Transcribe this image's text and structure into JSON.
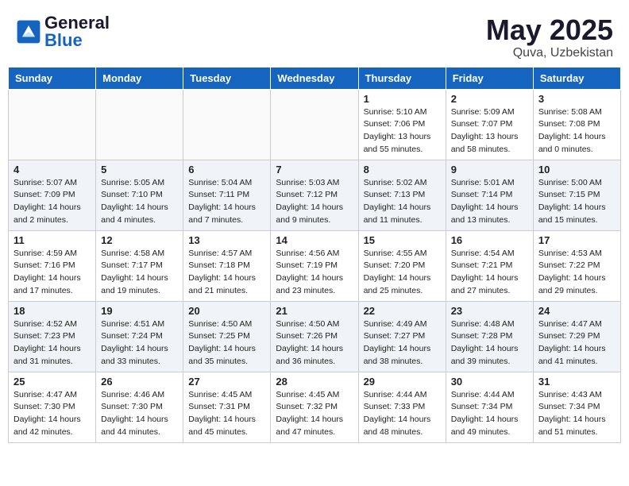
{
  "header": {
    "logo_general": "General",
    "logo_blue": "Blue",
    "month_year": "May 2025",
    "location": "Quva, Uzbekistan"
  },
  "weekdays": [
    "Sunday",
    "Monday",
    "Tuesday",
    "Wednesday",
    "Thursday",
    "Friday",
    "Saturday"
  ],
  "weeks": [
    [
      {
        "day": "",
        "sunrise": "",
        "sunset": "",
        "daylight": ""
      },
      {
        "day": "",
        "sunrise": "",
        "sunset": "",
        "daylight": ""
      },
      {
        "day": "",
        "sunrise": "",
        "sunset": "",
        "daylight": ""
      },
      {
        "day": "",
        "sunrise": "",
        "sunset": "",
        "daylight": ""
      },
      {
        "day": "1",
        "sunrise": "Sunrise: 5:10 AM",
        "sunset": "Sunset: 7:06 PM",
        "daylight": "Daylight: 13 hours and 55 minutes."
      },
      {
        "day": "2",
        "sunrise": "Sunrise: 5:09 AM",
        "sunset": "Sunset: 7:07 PM",
        "daylight": "Daylight: 13 hours and 58 minutes."
      },
      {
        "day": "3",
        "sunrise": "Sunrise: 5:08 AM",
        "sunset": "Sunset: 7:08 PM",
        "daylight": "Daylight: 14 hours and 0 minutes."
      }
    ],
    [
      {
        "day": "4",
        "sunrise": "Sunrise: 5:07 AM",
        "sunset": "Sunset: 7:09 PM",
        "daylight": "Daylight: 14 hours and 2 minutes."
      },
      {
        "day": "5",
        "sunrise": "Sunrise: 5:05 AM",
        "sunset": "Sunset: 7:10 PM",
        "daylight": "Daylight: 14 hours and 4 minutes."
      },
      {
        "day": "6",
        "sunrise": "Sunrise: 5:04 AM",
        "sunset": "Sunset: 7:11 PM",
        "daylight": "Daylight: 14 hours and 7 minutes."
      },
      {
        "day": "7",
        "sunrise": "Sunrise: 5:03 AM",
        "sunset": "Sunset: 7:12 PM",
        "daylight": "Daylight: 14 hours and 9 minutes."
      },
      {
        "day": "8",
        "sunrise": "Sunrise: 5:02 AM",
        "sunset": "Sunset: 7:13 PM",
        "daylight": "Daylight: 14 hours and 11 minutes."
      },
      {
        "day": "9",
        "sunrise": "Sunrise: 5:01 AM",
        "sunset": "Sunset: 7:14 PM",
        "daylight": "Daylight: 14 hours and 13 minutes."
      },
      {
        "day": "10",
        "sunrise": "Sunrise: 5:00 AM",
        "sunset": "Sunset: 7:15 PM",
        "daylight": "Daylight: 14 hours and 15 minutes."
      }
    ],
    [
      {
        "day": "11",
        "sunrise": "Sunrise: 4:59 AM",
        "sunset": "Sunset: 7:16 PM",
        "daylight": "Daylight: 14 hours and 17 minutes."
      },
      {
        "day": "12",
        "sunrise": "Sunrise: 4:58 AM",
        "sunset": "Sunset: 7:17 PM",
        "daylight": "Daylight: 14 hours and 19 minutes."
      },
      {
        "day": "13",
        "sunrise": "Sunrise: 4:57 AM",
        "sunset": "Sunset: 7:18 PM",
        "daylight": "Daylight: 14 hours and 21 minutes."
      },
      {
        "day": "14",
        "sunrise": "Sunrise: 4:56 AM",
        "sunset": "Sunset: 7:19 PM",
        "daylight": "Daylight: 14 hours and 23 minutes."
      },
      {
        "day": "15",
        "sunrise": "Sunrise: 4:55 AM",
        "sunset": "Sunset: 7:20 PM",
        "daylight": "Daylight: 14 hours and 25 minutes."
      },
      {
        "day": "16",
        "sunrise": "Sunrise: 4:54 AM",
        "sunset": "Sunset: 7:21 PM",
        "daylight": "Daylight: 14 hours and 27 minutes."
      },
      {
        "day": "17",
        "sunrise": "Sunrise: 4:53 AM",
        "sunset": "Sunset: 7:22 PM",
        "daylight": "Daylight: 14 hours and 29 minutes."
      }
    ],
    [
      {
        "day": "18",
        "sunrise": "Sunrise: 4:52 AM",
        "sunset": "Sunset: 7:23 PM",
        "daylight": "Daylight: 14 hours and 31 minutes."
      },
      {
        "day": "19",
        "sunrise": "Sunrise: 4:51 AM",
        "sunset": "Sunset: 7:24 PM",
        "daylight": "Daylight: 14 hours and 33 minutes."
      },
      {
        "day": "20",
        "sunrise": "Sunrise: 4:50 AM",
        "sunset": "Sunset: 7:25 PM",
        "daylight": "Daylight: 14 hours and 35 minutes."
      },
      {
        "day": "21",
        "sunrise": "Sunrise: 4:50 AM",
        "sunset": "Sunset: 7:26 PM",
        "daylight": "Daylight: 14 hours and 36 minutes."
      },
      {
        "day": "22",
        "sunrise": "Sunrise: 4:49 AM",
        "sunset": "Sunset: 7:27 PM",
        "daylight": "Daylight: 14 hours and 38 minutes."
      },
      {
        "day": "23",
        "sunrise": "Sunrise: 4:48 AM",
        "sunset": "Sunset: 7:28 PM",
        "daylight": "Daylight: 14 hours and 39 minutes."
      },
      {
        "day": "24",
        "sunrise": "Sunrise: 4:47 AM",
        "sunset": "Sunset: 7:29 PM",
        "daylight": "Daylight: 14 hours and 41 minutes."
      }
    ],
    [
      {
        "day": "25",
        "sunrise": "Sunrise: 4:47 AM",
        "sunset": "Sunset: 7:30 PM",
        "daylight": "Daylight: 14 hours and 42 minutes."
      },
      {
        "day": "26",
        "sunrise": "Sunrise: 4:46 AM",
        "sunset": "Sunset: 7:30 PM",
        "daylight": "Daylight: 14 hours and 44 minutes."
      },
      {
        "day": "27",
        "sunrise": "Sunrise: 4:45 AM",
        "sunset": "Sunset: 7:31 PM",
        "daylight": "Daylight: 14 hours and 45 minutes."
      },
      {
        "day": "28",
        "sunrise": "Sunrise: 4:45 AM",
        "sunset": "Sunset: 7:32 PM",
        "daylight": "Daylight: 14 hours and 47 minutes."
      },
      {
        "day": "29",
        "sunrise": "Sunrise: 4:44 AM",
        "sunset": "Sunset: 7:33 PM",
        "daylight": "Daylight: 14 hours and 48 minutes."
      },
      {
        "day": "30",
        "sunrise": "Sunrise: 4:44 AM",
        "sunset": "Sunset: 7:34 PM",
        "daylight": "Daylight: 14 hours and 49 minutes."
      },
      {
        "day": "31",
        "sunrise": "Sunrise: 4:43 AM",
        "sunset": "Sunset: 7:34 PM",
        "daylight": "Daylight: 14 hours and 51 minutes."
      }
    ]
  ]
}
